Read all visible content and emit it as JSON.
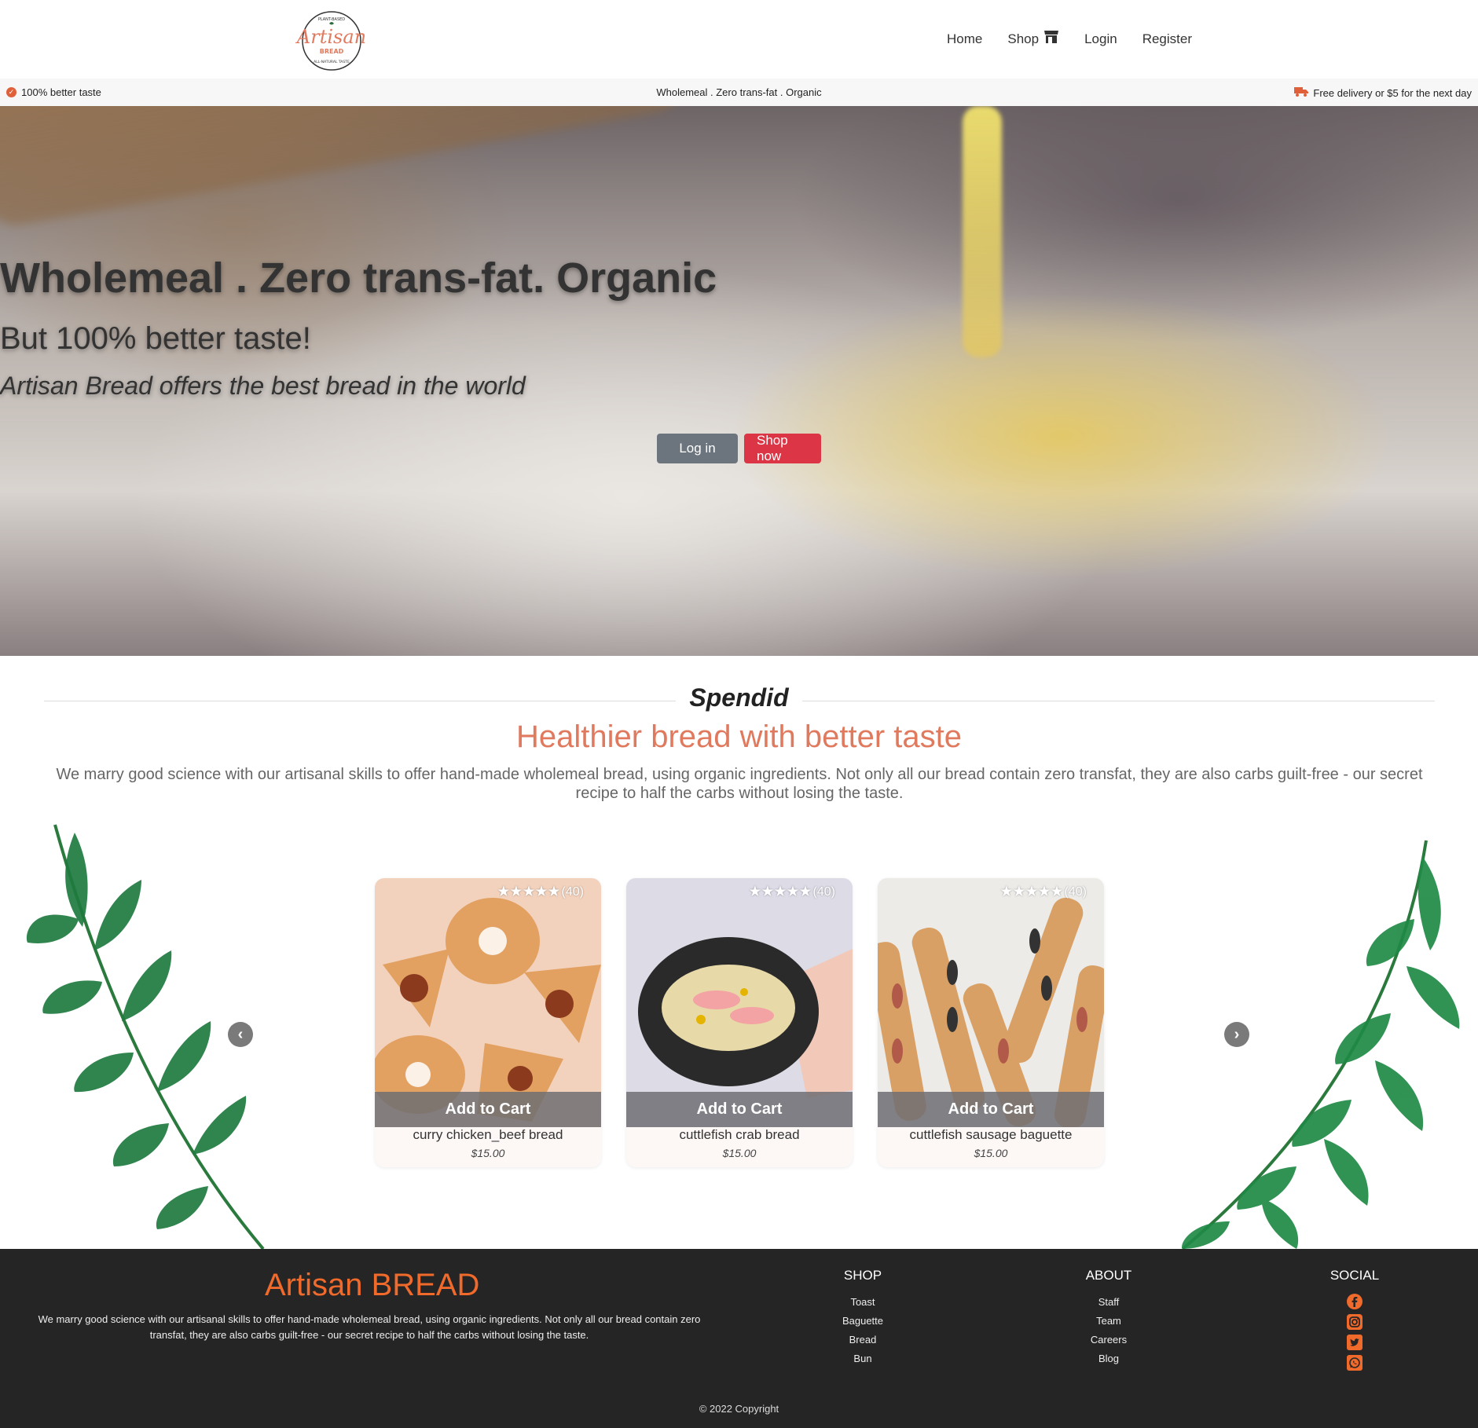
{
  "nav": {
    "logo": {
      "top_text": "PLANT-BASED",
      "brand": "Artisan",
      "sub": "BREAD",
      "bottom_text": "ALL-NATURAL TASTE"
    },
    "links": [
      "Home",
      "Shop",
      "Login",
      "Register"
    ]
  },
  "topbar": {
    "left": "100% better taste",
    "center": "Wholemeal . Zero trans-fat . Organic",
    "right": "Free delivery or $5 for the next day"
  },
  "hero": {
    "title": "Wholemeal . Zero trans-fat. Organic",
    "subtitle": "But 100% better taste!",
    "tagline": "Artisan Bread offers the best bread in the world",
    "login_button": "Log in",
    "shop_button": "Shop now"
  },
  "intro": {
    "kicker": "Spendid",
    "heading": "Healthier bread with better taste",
    "text": "We marry good science with our artisanal skills to offer hand-made wholemeal bread, using organic ingredients. Not only all our bread contain zero transfat, they are also carbs guilt-free - our secret recipe to half the carbs without losing the taste."
  },
  "products": [
    {
      "name": "curry chicken_beef bread",
      "price": "$15.00",
      "stars": "★★★★★",
      "reviews": "(40)",
      "cta": "Add to Cart"
    },
    {
      "name": "cuttlefish crab bread",
      "price": "$15.00",
      "stars": "★★★★★",
      "reviews": "(40)",
      "cta": "Add to Cart"
    },
    {
      "name": "cuttlefish sausage baguette",
      "price": "$15.00",
      "stars": "★★★★★",
      "reviews": "(40)",
      "cta": "Add to Cart"
    }
  ],
  "carousel": {
    "prev_icon": "chevron-left-icon",
    "next_icon": "chevron-right-icon"
  },
  "footer": {
    "brand": "Artisan BREAD",
    "about": "We marry good science with our artisanal skills to offer hand-made wholemeal bread, using organic ingredients. Not only all our bread contain zero transfat, they are also carbs guilt-free - our secret recipe to half the carbs without losing the taste.",
    "shop": {
      "title": "SHOP",
      "items": [
        "Toast",
        "Baguette",
        "Bread",
        "Bun"
      ]
    },
    "about_col": {
      "title": "ABOUT",
      "items": [
        "Staff",
        "Team",
        "Careers",
        "Blog"
      ]
    },
    "social": {
      "title": "SOCIAL",
      "icons": [
        "facebook-icon",
        "instagram-icon",
        "twitter-icon",
        "whatsapp-icon"
      ]
    },
    "copyright": "© 2022 Copyright"
  },
  "colors": {
    "accent": "#e07a5f",
    "brand_orange": "#f06a2c",
    "footer_bg": "#252525",
    "btn_red": "#dc3545",
    "btn_gray": "#6c757d"
  }
}
